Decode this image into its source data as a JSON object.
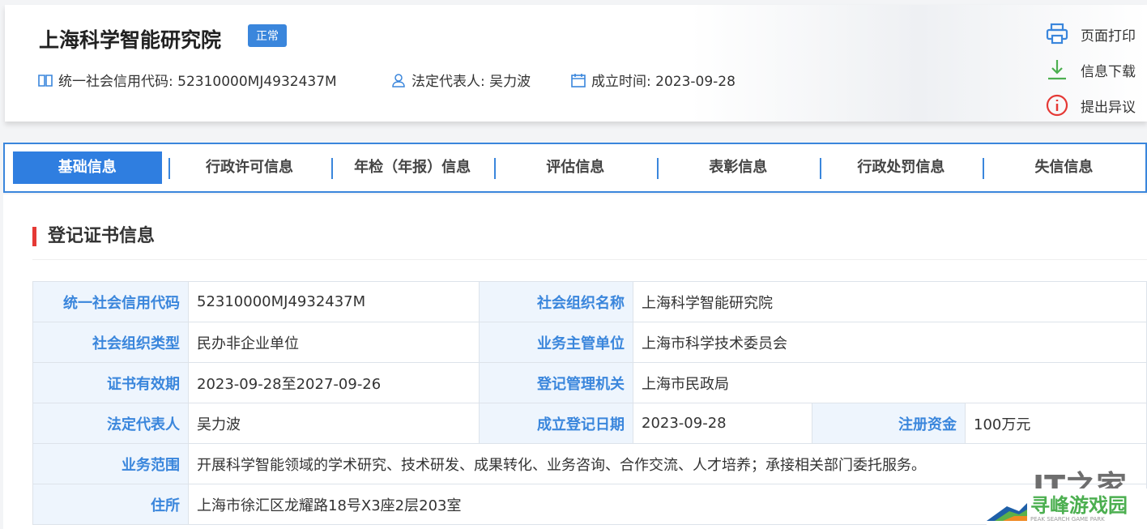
{
  "header": {
    "title": "上海科学智能研究院",
    "status": "正常",
    "credit_code": "统一社会信用代码: 52310000MJ4932437M",
    "legal_rep": "法定代表人: 吴力波",
    "founded": "成立时间: 2023-09-28",
    "actions": [
      {
        "label": "页面打印",
        "icon": "printer-icon"
      },
      {
        "label": "信息下载",
        "icon": "download-icon"
      },
      {
        "label": "提出异议",
        "icon": "info-icon"
      }
    ]
  },
  "tabs": [
    "基础信息",
    "行政许可信息",
    "年检（年报）信息",
    "评估信息",
    "表彰信息",
    "行政处罚信息",
    "失信信息"
  ],
  "section_title": "登记证书信息",
  "table": {
    "r0": [
      "统一社会信用代码",
      "52310000MJ4932437M",
      "社会组织名称",
      "上海科学智能研究院"
    ],
    "r1": [
      "社会组织类型",
      "民办非企业单位",
      "业务主管单位",
      "上海市科学技术委员会"
    ],
    "r2": [
      "证书有效期",
      "2023-09-28至2027-09-26",
      "登记管理机关",
      "上海市民政局"
    ],
    "r3": [
      "法定代表人",
      "吴力波",
      "成立登记日期",
      "2023-09-28",
      "注册资金",
      "100万元"
    ],
    "r4": [
      "业务范围",
      "开展科学智能领域的学术研究、技术研发、成果转化、业务咨询、合作交流、人才培养；承接相关部门委托服务。"
    ],
    "r5": [
      "住所",
      "上海市徐汇区龙耀路18号X3座2层203室"
    ]
  },
  "watermarks": {
    "ithome": "IT之家",
    "peak": "寻峰游戏园",
    "peak_en": "PEAK SEARCH GAME PARK"
  }
}
